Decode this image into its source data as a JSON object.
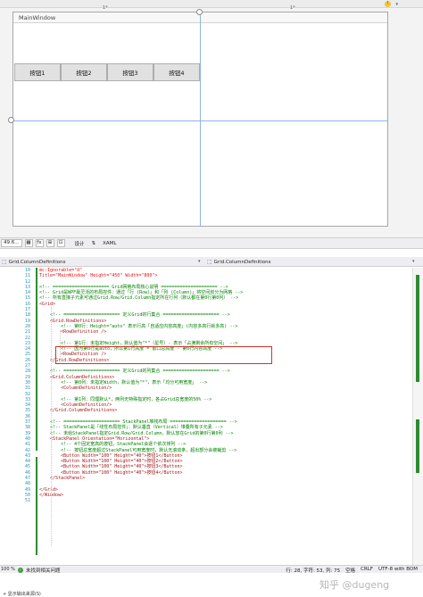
{
  "designer": {
    "window_title": "MainWindow",
    "col_star_left": "1*",
    "col_star_right": "1*",
    "buttons": [
      "按钮1",
      "按钮2",
      "按钮3",
      "按钮4"
    ],
    "hint_glyph": "lightbulb-icon"
  },
  "zoom_bar": {
    "zoom": "49.6...",
    "fx_label": "fx",
    "design_tab": "设计",
    "swap_glyph": "⇅",
    "xaml_tab": "XAML"
  },
  "editor_header": {
    "left_crumb": "Grid.ColumnDefinitions",
    "right_crumb": "Grid.ColumnDefinitions"
  },
  "code": {
    "lines": [
      {
        "n": "10",
        "t": "mc:Ignorable=\"d\"",
        "k": "attr"
      },
      {
        "n": "11",
        "t": "Title=\"MainWindow\" Height=\"450\" Width=\"800\">",
        "k": "attr"
      },
      {
        "n": "12",
        "t": "",
        "k": "plain"
      },
      {
        "n": "13",
        "t": "<!-- ===================== Grid网格布局核心说明 ===================== -->",
        "k": "comment"
      },
      {
        "n": "14",
        "t": "<!-- Grid是WPF最灵活的布局控件：通过「行 (Row)」和「列 (Column)」将空间划分为网格 -->",
        "k": "comment"
      },
      {
        "n": "15",
        "t": "<!-- 所有直接子元素可通过Grid.Row/Grid.Column指定所在行列（默认都在第0行第0列） -->",
        "k": "comment"
      },
      {
        "n": "16",
        "t": "<Grid>",
        "k": "tag"
      },
      {
        "n": "17",
        "t": "",
        "k": "plain"
      },
      {
        "n": "18",
        "t": "    <!-- ===================== 定义Grid的行集合 ===================== -->",
        "k": "comment"
      },
      {
        "n": "19",
        "t": "    <Grid.RowDefinitions>",
        "k": "tag"
      },
      {
        "n": "20",
        "t": "        <!-- 第0行：Height=\"auto\" 表示行高「自适应内容高度」(内容多高行就多高) -->",
        "k": "comment"
      },
      {
        "n": "21",
        "t": "        <RowDefinition />",
        "k": "tag"
      },
      {
        "n": "22",
        "t": "",
        "k": "plain"
      },
      {
        "n": "23",
        "t": "        <!-- 第1行：未指定Height，默认值为\"*\"（星号）- 表示「占满剩余所有空间」 -->",
        "k": "comment"
      },
      {
        "n": "24",
        "t": "        <!-- 因为第0行是auto，所以第1行高度 = 窗口总高度 - 第0行内容高度 -->",
        "k": "comment"
      },
      {
        "n": "25",
        "t": "        <RowDefinition />",
        "k": "tag"
      },
      {
        "n": "26",
        "t": "    </Grid.RowDefinitions>",
        "k": "tag"
      },
      {
        "n": "27",
        "t": "",
        "k": "plain"
      },
      {
        "n": "28",
        "t": "    <!-- ===================== 定义Grid的列集合 ===================== -->",
        "k": "comment"
      },
      {
        "n": "29",
        "t": "    <Grid.ColumnDefinitions>",
        "k": "tag"
      },
      {
        "n": "30",
        "t": "        <!-- 第0列：未指定Width，默认值为\"*\"，表示「均分可用宽度」 -->",
        "k": "comment"
      },
      {
        "n": "31",
        "t": "        <ColumnDefinition/>",
        "k": "tag"
      },
      {
        "n": "32",
        "t": "",
        "k": "plain"
      },
      {
        "n": "33",
        "t": "        <!-- 第1列：同理默认*，两列无特殊指定时，各占Grid总宽度的50% -->",
        "k": "comment"
      },
      {
        "n": "34",
        "t": "        <ColumnDefinition/>",
        "k": "tag"
      },
      {
        "n": "35",
        "t": "    </Grid.ColumnDefinitions>",
        "k": "tag"
      },
      {
        "n": "36",
        "t": "",
        "k": "plain"
      },
      {
        "n": "37",
        "t": "    <!-- ===================== StackPanel堆栈布局 ===================== -->",
        "k": "comment"
      },
      {
        "n": "38",
        "t": "    <!-- StackPanel是「线性布局控件」：默认垂直（Vertical）堆叠所有子元素 -->",
        "k": "comment"
      },
      {
        "n": "39",
        "t": "    <!-- 未给StackPanel指定Grid.Row/Grid.Column，默认放在Grid的第0行第0列 -->",
        "k": "comment"
      },
      {
        "n": "40",
        "t": "    <StackPanel Orientation=\"Horizontal\">",
        "k": "tag"
      },
      {
        "n": "41",
        "t": "        <!-- 4个固定宽高的按钮，StackPanel会逐个依次排列 -->",
        "k": "comment"
      },
      {
        "n": "42",
        "t": "        <!-- 按钮总宽度超过StackPanel可用宽度时，默认无滚动条，超出部分会被裁剪 -->",
        "k": "comment"
      },
      {
        "n": "43",
        "t": "        <Button Width=\"100\" Height=\"40\">按钮1</Button>",
        "k": "tag"
      },
      {
        "n": "44",
        "t": "        <Button Width=\"100\" Height=\"40\">按钮2</Button>",
        "k": "tag"
      },
      {
        "n": "45",
        "t": "        <Button Width=\"100\" Height=\"40\">按钮3</Button>",
        "k": "tag"
      },
      {
        "n": "46",
        "t": "        <Button Width=\"100\" Height=\"40\">按钮4</Button>",
        "k": "tag"
      },
      {
        "n": "47",
        "t": "    </StackPanel>",
        "k": "tag"
      },
      {
        "n": "48",
        "t": "",
        "k": "plain"
      },
      {
        "n": "49",
        "t": "</Grid>",
        "k": "tag"
      },
      {
        "n": "50",
        "t": "</Window>",
        "k": "tag"
      },
      {
        "n": "51",
        "t": "",
        "k": "plain"
      }
    ]
  },
  "status": {
    "zoom": "100 %",
    "message": "未找到相关问题",
    "position": "行: 28, 字符: 53, 列: 75",
    "mode": "空格",
    "eol": "CRLF",
    "encoding": "UTF-8 with BOM"
  },
  "bottom": {
    "text": "+ 显示输出来源(S)",
    "watermark": "知乎 @dugeng"
  },
  "colors": {
    "highlight_border": "#d0332b",
    "comment": "#008000",
    "tag": "#a31515",
    "change_bar": "#2e8b30"
  }
}
